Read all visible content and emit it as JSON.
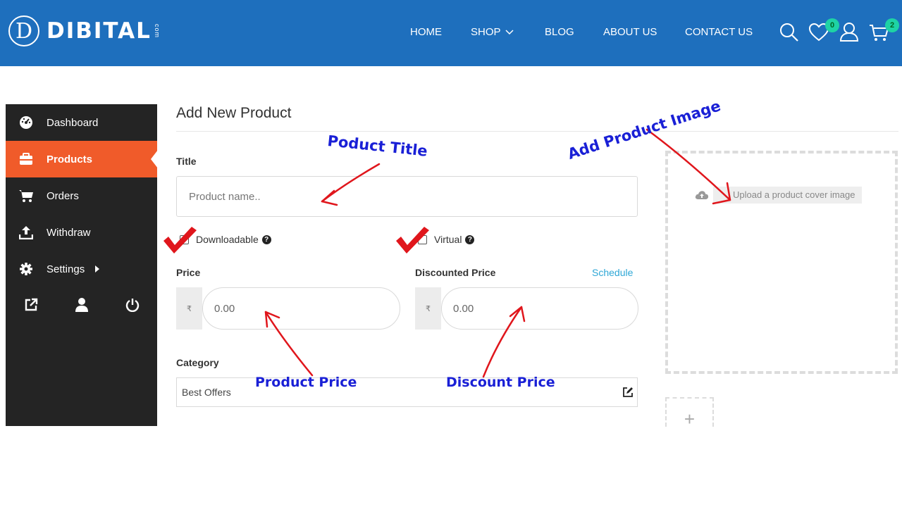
{
  "header": {
    "logo_letter": "D",
    "logo_text": "DIBITAL",
    "logo_suffix": "com",
    "nav": [
      "HOME",
      "SHOP",
      "BLOG",
      "ABOUT US",
      "CONTACT US"
    ],
    "wishlist_count": "0",
    "cart_count": "2",
    "bg_color": "#1e6fbd",
    "badge_color": "#1ed3a5"
  },
  "sidebar": {
    "items": [
      {
        "label": "Dashboard",
        "icon": "gauge-icon"
      },
      {
        "label": "Products",
        "icon": "briefcase-icon",
        "active": true
      },
      {
        "label": "Orders",
        "icon": "cart-icon"
      },
      {
        "label": "Withdraw",
        "icon": "upload-icon"
      },
      {
        "label": "Settings",
        "icon": "gear-icon"
      }
    ],
    "bottom_icons": [
      "external-link-icon",
      "user-icon",
      "power-icon"
    ],
    "active_color": "#f05b2a"
  },
  "form": {
    "page_title": "Add New Product",
    "title_label": "Title",
    "title_placeholder": "Product name..",
    "downloadable_label": "Downloadable",
    "virtual_label": "Virtual",
    "price_label": "Price",
    "discounted_label": "Discounted Price",
    "schedule_label": "Schedule",
    "currency_symbol": "₹",
    "price_placeholder": "0.00",
    "discount_placeholder": "0.00",
    "category_label": "Category",
    "category_value": "Best Offers"
  },
  "upload": {
    "cover_label": "Upload a product cover image",
    "gallery_add": "+"
  },
  "annotations": {
    "title": "Poduct Title",
    "image": "Add Product Image",
    "price": "Product Price",
    "discount": "Discount Price",
    "color": "#1a20d6",
    "arrow_color": "#e0161c"
  }
}
